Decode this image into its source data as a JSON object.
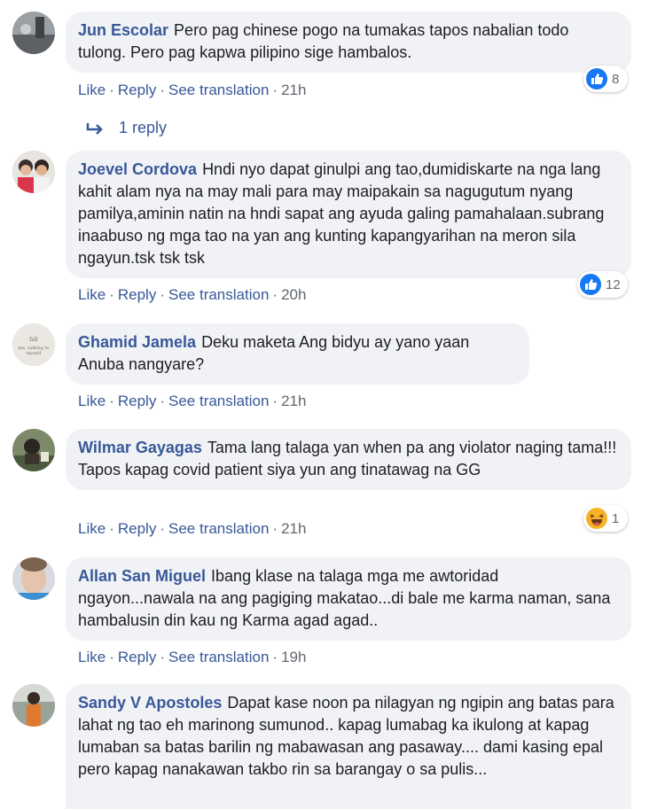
{
  "comments": [
    {
      "author": "Jun Escolar",
      "text": "Pero pag chinese pogo na tumakas tapos nabalian todo tulong. Pero pag kapwa pilipino sige hambalos.",
      "actions": {
        "like": "Like",
        "reply": "Reply",
        "translate": "See translation",
        "time": "21h"
      },
      "reaction": {
        "type": "like",
        "count": "8"
      }
    },
    {
      "author": "Joevel Cordova",
      "text": "Hndi nyo dapat ginulpi ang tao,dumidiskarte na nga lang kahit alam nya na may mali para may maipakain sa nagugutum nyang pamilya,aminin natin na hndi sapat ang ayuda galing pamahalaan.subrang inaabuso ng mga tao na yan ang kunting kapangyarihan na meron sila ngayun.tsk tsk tsk",
      "actions": {
        "like": "Like",
        "reply": "Reply",
        "translate": "See translation",
        "time": "20h"
      },
      "reaction": {
        "type": "like",
        "count": "12"
      }
    },
    {
      "author": "Ghamid Jamela",
      "text": "Deku maketa Ang bidyu ay yano yaan Anuba nangyare?",
      "actions": {
        "like": "Like",
        "reply": "Reply",
        "translate": "See translation",
        "time": "21h"
      }
    },
    {
      "author": "Wilmar Gayagas",
      "text": "Tama lang talaga yan when pa ang violator naging tama!!! Tapos kapag covid patient siya yun ang tinatawag na GG",
      "actions": {
        "like": "Like",
        "reply": "Reply",
        "translate": "See translation",
        "time": "21h"
      },
      "reaction": {
        "type": "haha",
        "count": "1"
      }
    },
    {
      "author": "Allan San Miguel",
      "text": "Ibang klase na talaga mga me awtoridad ngayon...nawala na ang pagiging makatao...di bale me karma naman, sana hambalusin din kau ng Karma agad agad..",
      "actions": {
        "like": "Like",
        "reply": "Reply",
        "translate": "See translation",
        "time": "19h"
      }
    },
    {
      "author": "Sandy V Apostoles",
      "text": "Dapat kase noon pa nilagyan ng ngipin ang batas para lahat ng tao eh marinong sumunod.. kapag lumabag ka ikulong at kapag lumaban sa batas barilin ng mabawasan ang pasaway.... dami kasing epal pero kapag nanakawan takbo rin sa barangay o sa pulis..."
    }
  ],
  "reply_thread": {
    "label": "1 reply"
  },
  "colors": {
    "link": "#385898",
    "bubble": "#f0f2f5",
    "muted": "#606770",
    "like_blue": "#1877f2",
    "haha_yellow": "#f7b125"
  }
}
